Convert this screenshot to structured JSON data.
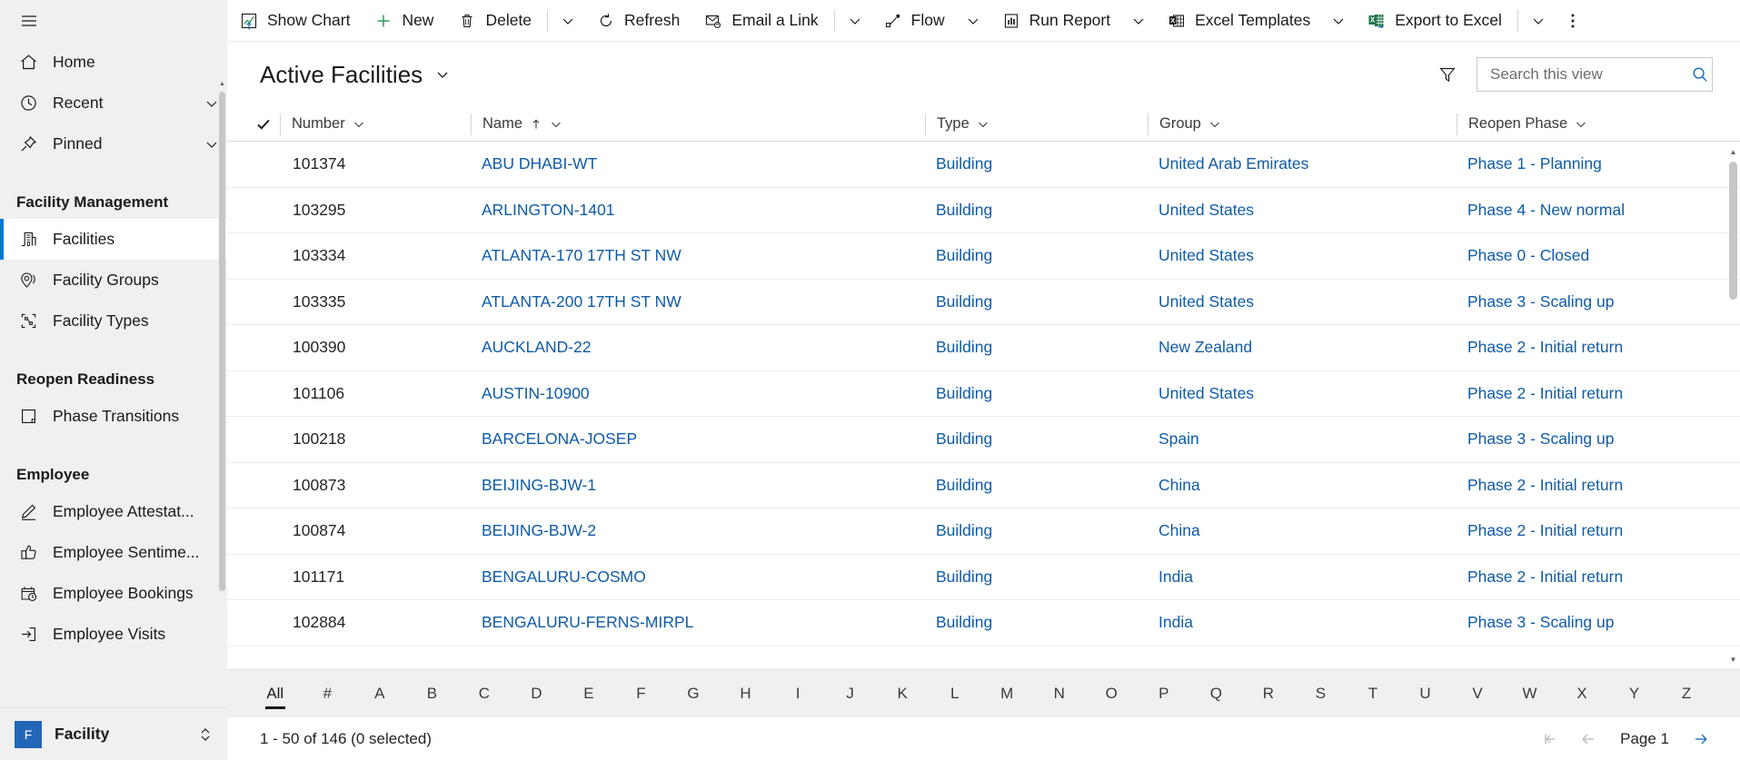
{
  "commandbar": {
    "items": [
      {
        "label": "Show Chart",
        "icon": "show-chart-icon",
        "caret": false
      },
      {
        "label": "New",
        "icon": "plus-icon",
        "caret": false
      },
      {
        "label": "Delete",
        "icon": "trash-icon",
        "caret": true
      },
      {
        "label": "Refresh",
        "icon": "refresh-icon",
        "caret": false
      },
      {
        "label": "Email a Link",
        "icon": "email-link-icon",
        "caret": true
      },
      {
        "label": "Flow",
        "icon": "flow-icon",
        "caret": true
      },
      {
        "label": "Run Report",
        "icon": "run-report-icon",
        "caret": true
      },
      {
        "label": "Excel Templates",
        "icon": "excel-template-icon",
        "caret": true
      },
      {
        "label": "Export to Excel",
        "icon": "export-excel-icon",
        "caret": true
      }
    ],
    "overflow_label": "More commands"
  },
  "sidebar": {
    "hamburger_label": "Site Map",
    "quick": [
      {
        "label": "Home",
        "icon": "home-icon",
        "chevron": false
      },
      {
        "label": "Recent",
        "icon": "clock-icon",
        "chevron": true
      },
      {
        "label": "Pinned",
        "icon": "pin-icon",
        "chevron": true
      }
    ],
    "groups": [
      {
        "title": "Facility Management",
        "items": [
          {
            "label": "Facilities",
            "icon": "building-icon",
            "selected": true
          },
          {
            "label": "Facility Groups",
            "icon": "location-group-icon",
            "selected": false
          },
          {
            "label": "Facility Types",
            "icon": "shapes-icon",
            "selected": false
          }
        ]
      },
      {
        "title": "Reopen Readiness",
        "items": [
          {
            "label": "Phase Transitions",
            "icon": "page-icon",
            "selected": false
          }
        ]
      },
      {
        "title": "Employee",
        "items": [
          {
            "label": "Employee Attestat...",
            "icon": "pencil-icon",
            "selected": false
          },
          {
            "label": "Employee Sentime...",
            "icon": "thumbs-up-icon",
            "selected": false
          },
          {
            "label": "Employee Bookings",
            "icon": "calendar-clock-icon",
            "selected": false
          },
          {
            "label": "Employee Visits",
            "icon": "signin-icon",
            "selected": false
          }
        ]
      }
    ],
    "app_switcher": {
      "initial": "F",
      "name": "Facility",
      "tile_color": "#2266b8"
    }
  },
  "view": {
    "title": "Active Facilities",
    "filter_label": "Edit filters",
    "search": {
      "placeholder": "Search this view",
      "value": ""
    }
  },
  "grid": {
    "columns": [
      {
        "key": "number",
        "label": "Number",
        "sorted": ""
      },
      {
        "key": "name",
        "label": "Name",
        "sorted": "asc"
      },
      {
        "key": "type",
        "label": "Type",
        "sorted": ""
      },
      {
        "key": "group",
        "label": "Group",
        "sorted": ""
      },
      {
        "key": "phase",
        "label": "Reopen Phase",
        "sorted": ""
      }
    ],
    "rows": [
      {
        "number": "101374",
        "name": "ABU DHABI-WT",
        "type": "Building",
        "group": "United Arab Emirates",
        "phase": "Phase 1 - Planning"
      },
      {
        "number": "103295",
        "name": "ARLINGTON-1401",
        "type": "Building",
        "group": "United States",
        "phase": "Phase 4 - New normal"
      },
      {
        "number": "103334",
        "name": "ATLANTA-170 17TH ST NW",
        "type": "Building",
        "group": "United States",
        "phase": "Phase 0 - Closed"
      },
      {
        "number": "103335",
        "name": "ATLANTA-200 17TH ST NW",
        "type": "Building",
        "group": "United States",
        "phase": "Phase 3 - Scaling up"
      },
      {
        "number": "100390",
        "name": "AUCKLAND-22",
        "type": "Building",
        "group": "New Zealand",
        "phase": "Phase 2 - Initial return"
      },
      {
        "number": "101106",
        "name": "AUSTIN-10900",
        "type": "Building",
        "group": "United States",
        "phase": "Phase 2 - Initial return"
      },
      {
        "number": "100218",
        "name": "BARCELONA-JOSEP",
        "type": "Building",
        "group": "Spain",
        "phase": "Phase 3 - Scaling up"
      },
      {
        "number": "100873",
        "name": "BEIJING-BJW-1",
        "type": "Building",
        "group": "China",
        "phase": "Phase 2 - Initial return"
      },
      {
        "number": "100874",
        "name": "BEIJING-BJW-2",
        "type": "Building",
        "group": "China",
        "phase": "Phase 2 - Initial return"
      },
      {
        "number": "101171",
        "name": "BENGALURU-COSMO",
        "type": "Building",
        "group": "India",
        "phase": "Phase 2 - Initial return"
      },
      {
        "number": "102884",
        "name": "BENGALURU-FERNS-MIRPL",
        "type": "Building",
        "group": "India",
        "phase": "Phase 3 - Scaling up"
      }
    ]
  },
  "alphabet": {
    "active": "All",
    "items": [
      "All",
      "#",
      "A",
      "B",
      "C",
      "D",
      "E",
      "F",
      "G",
      "H",
      "I",
      "J",
      "K",
      "L",
      "M",
      "N",
      "O",
      "P",
      "Q",
      "R",
      "S",
      "T",
      "U",
      "V",
      "W",
      "X",
      "Y",
      "Z"
    ]
  },
  "footer": {
    "status": "1 - 50 of 146 (0 selected)",
    "page_label": "Page 1",
    "first_label": "First page",
    "prev_label": "Previous page",
    "next_label": "Next page"
  },
  "colors": {
    "accent": "#0f6cbd",
    "link": "#0f5ba7",
    "selected_rail": "#0078d4",
    "excel_green": "#1e7145",
    "sidebar_bg": "#f0f0f0"
  }
}
